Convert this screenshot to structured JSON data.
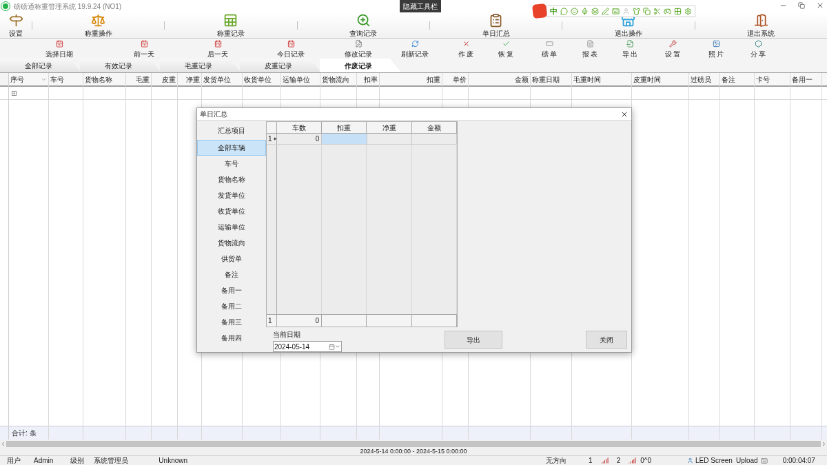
{
  "window": {
    "title": "磅磅通称重管理系统 19.9.24 (NO1)",
    "tooltip": "隐藏工具栏"
  },
  "ime_bar": {
    "mode": "中"
  },
  "main_toolbar": [
    {
      "label": "设置"
    },
    {
      "label": "称重操作"
    },
    {
      "label": "称重记录"
    },
    {
      "label": "查询记录"
    },
    {
      "label": "单日汇总"
    },
    {
      "label": "退出操作"
    },
    {
      "label": "退出系统"
    }
  ],
  "sub_toolbar": [
    {
      "label": "选择日期"
    },
    {
      "label": "前一天"
    },
    {
      "label": "后一天"
    },
    {
      "label": "今日记录"
    },
    {
      "label": "修改记录"
    },
    {
      "label": "刷新记录"
    },
    {
      "label": "作 废"
    },
    {
      "label": "恢 复"
    },
    {
      "label": "磅 单"
    },
    {
      "label": "报 表"
    },
    {
      "label": "导 出"
    },
    {
      "label": "设 置"
    },
    {
      "label": "照 片"
    },
    {
      "label": "分 享"
    }
  ],
  "tabs": [
    {
      "label": "全部记录",
      "selected": false
    },
    {
      "label": "有效记录",
      "selected": false
    },
    {
      "label": "毛重记录",
      "selected": false
    },
    {
      "label": "皮重记录",
      "selected": false
    },
    {
      "label": "作废记录",
      "selected": true
    }
  ],
  "table": {
    "columns": [
      {
        "label": "序号",
        "right_aligned": false,
        "menu": true
      },
      {
        "label": "车号",
        "right_aligned": false,
        "menu": false
      },
      {
        "label": "货物名称",
        "right_aligned": false,
        "menu": false
      },
      {
        "label": "毛重",
        "right_aligned": true,
        "menu": false
      },
      {
        "label": "皮重",
        "right_aligned": true,
        "menu": false
      },
      {
        "label": "净重",
        "right_aligned": true,
        "menu": false
      },
      {
        "label": "发货单位",
        "right_aligned": false,
        "menu": false
      },
      {
        "label": "收货单位",
        "right_aligned": false,
        "menu": false
      },
      {
        "label": "运输单位",
        "right_aligned": false,
        "menu": false
      },
      {
        "label": "货物流向",
        "right_aligned": false,
        "menu": false
      },
      {
        "label": "扣率",
        "right_aligned": true,
        "menu": false
      },
      {
        "label": "扣重",
        "right_aligned": true,
        "menu": false
      },
      {
        "label": "单价",
        "right_aligned": true,
        "menu": false
      },
      {
        "label": "金额",
        "right_aligned": true,
        "menu": false
      },
      {
        "label": "称重日期",
        "right_aligned": false,
        "menu": false
      },
      {
        "label": "毛重时间",
        "right_aligned": false,
        "menu": false
      },
      {
        "label": "皮重时间",
        "right_aligned": false,
        "menu": false
      },
      {
        "label": "过磅员",
        "right_aligned": false,
        "menu": false
      },
      {
        "label": "备注",
        "right_aligned": false,
        "menu": false
      },
      {
        "label": "卡号",
        "right_aligned": false,
        "menu": false
      },
      {
        "label": "备用一",
        "right_aligned": false,
        "menu": false
      }
    ],
    "footer": "合计: 条"
  },
  "date_range": "2024-5-14 0:00:00 - 2024-5-15 0:00:00",
  "status_bar": {
    "user_label": "用户",
    "user": "Admin",
    "role_label": "级别",
    "role": "系统管理员",
    "device": "Unknown",
    "direction": "无方向",
    "channel_1": "1",
    "channel_2": "2",
    "counter": "0^0",
    "led": "LED Screen",
    "upload": "Upload",
    "timer": "0:00:04:07"
  },
  "dialog": {
    "title": "单日汇总",
    "items_header": "汇总项目",
    "items": [
      {
        "label": "全部车辆",
        "selected": true
      },
      {
        "label": "车号",
        "selected": false
      },
      {
        "label": "货物名称",
        "selected": false
      },
      {
        "label": "发货单位",
        "selected": false
      },
      {
        "label": "收货单位",
        "selected": false
      },
      {
        "label": "运输单位",
        "selected": false
      },
      {
        "label": "货物流向",
        "selected": false
      },
      {
        "label": "供货单",
        "selected": false
      },
      {
        "label": "备注",
        "selected": false
      },
      {
        "label": "备用一",
        "selected": false
      },
      {
        "label": "备用二",
        "selected": false
      },
      {
        "label": "备用三",
        "selected": false
      },
      {
        "label": "备用四",
        "selected": false
      }
    ],
    "grid": {
      "columns": [
        "车数",
        "扣重",
        "净重",
        "金额"
      ],
      "rows": [
        {
          "index": "1",
          "cells": [
            {
              "text": "0",
              "selected": false
            },
            {
              "selected": true
            },
            {
              "selected": false
            },
            {
              "selected": false
            }
          ]
        }
      ],
      "footer": {
        "index": "1",
        "cells": [
          "0"
        ]
      }
    },
    "date_label": "当前日期",
    "date_value": "2024-05-14",
    "buttons": [
      "导出",
      "关闭"
    ]
  }
}
